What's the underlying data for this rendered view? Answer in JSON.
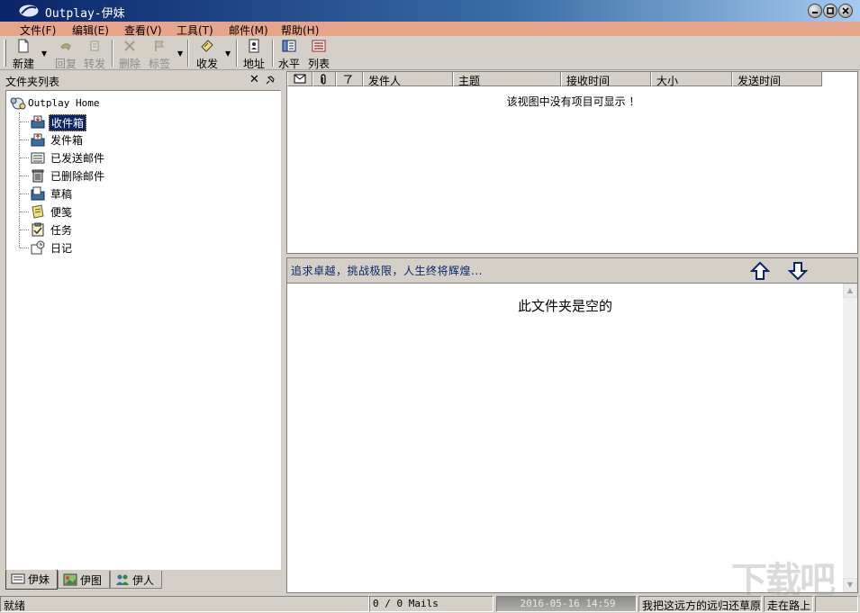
{
  "window": {
    "title": "Outplay-伊妹",
    "buttons": [
      "minimize-icon",
      "maximize-icon",
      "close-icon"
    ]
  },
  "menu": [
    "文件(F)",
    "编辑(E)",
    "查看(V)",
    "工具(T)",
    "邮件(M)",
    "帮助(H)"
  ],
  "toolbar": {
    "new": "新建",
    "reply": "回复",
    "forward": "转发",
    "delete": "删除",
    "tag": "标签",
    "send_receive": "收发",
    "address": "地址",
    "horizontal": "水平",
    "list": "列表"
  },
  "folder_panel": {
    "title": "文件夹列表",
    "root": "Outplay Home",
    "folders": [
      {
        "label": "收件箱",
        "icon": "inbox-icon",
        "selected": true
      },
      {
        "label": "发件箱",
        "icon": "outbox-icon",
        "selected": false
      },
      {
        "label": "已发送邮件",
        "icon": "sent-mail-icon",
        "selected": false
      },
      {
        "label": "已删除邮件",
        "icon": "trash-icon",
        "selected": false
      },
      {
        "label": "草稿",
        "icon": "draft-icon",
        "selected": false
      },
      {
        "label": "便笺",
        "icon": "note-icon",
        "selected": false
      },
      {
        "label": "任务",
        "icon": "task-icon",
        "selected": false
      },
      {
        "label": "日记",
        "icon": "diary-icon",
        "selected": false
      }
    ],
    "tabs": [
      "伊妹",
      "伊图",
      "伊人"
    ]
  },
  "message_list": {
    "columns": [
      "发件人",
      "主题",
      "接收时间",
      "大小",
      "发送时间"
    ],
    "empty_text": "该视图中没有项目可显示 ！"
  },
  "preview": {
    "motto": "追求卓越，挑战极限，人生终将辉煌...",
    "empty_text": "此文件夹是空的"
  },
  "status": {
    "ready": "就绪",
    "mail_count": "0 / 0 Mails",
    "datetime": "2016-05-16 14:59",
    "message": "我把这远方的远归还草原",
    "message2": "走在路上"
  },
  "watermark": "下载吧",
  "colors": {
    "titlebar": "#0a246a",
    "menubar": "#e6a48a",
    "selection": "#0a246a",
    "motto": "#0a246a"
  }
}
